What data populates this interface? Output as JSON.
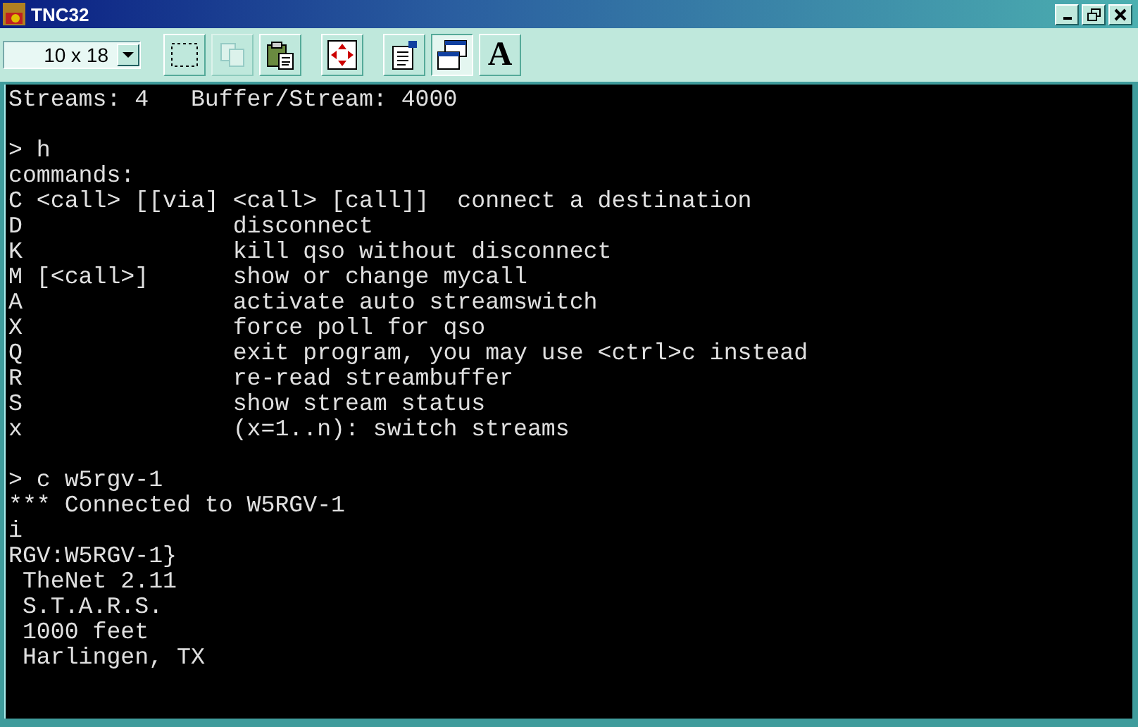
{
  "window": {
    "title": "TNC32"
  },
  "toolbar": {
    "font_size": "10 x 18",
    "buttons": [
      {
        "kind": "select",
        "disabled": false,
        "pressed": false
      },
      {
        "kind": "copy",
        "disabled": true,
        "pressed": false
      },
      {
        "kind": "paste",
        "disabled": false,
        "pressed": false
      },
      {
        "kind": "move",
        "disabled": false,
        "pressed": false
      },
      {
        "kind": "properties",
        "disabled": false,
        "pressed": false
      },
      {
        "kind": "window",
        "disabled": false,
        "pressed": true
      },
      {
        "kind": "font",
        "label": "A",
        "disabled": false,
        "pressed": false
      }
    ]
  },
  "terminal": {
    "blocks": [
      [
        "Streams: 4   Buffer/Stream: 4000"
      ],
      [
        "> h",
        "commands:",
        "C <call> [[via] <call> [call]]  connect a destination",
        "D               disconnect",
        "K               kill qso without disconnect",
        "M [<call>]      show or change mycall",
        "A               activate auto streamswitch",
        "X               force poll for qso",
        "Q               exit program, you may use <ctrl>c instead",
        "R               re-read streambuffer",
        "S               show stream status",
        "x               (x=1..n): switch streams"
      ],
      [
        "> c w5rgv-1",
        "*** Connected to W5RGV-1",
        "i",
        "RGV:W5RGV-1}",
        " TheNet 2.11",
        " S.T.A.R.S.",
        " 1000 feet",
        " Harlingen, TX"
      ]
    ]
  }
}
